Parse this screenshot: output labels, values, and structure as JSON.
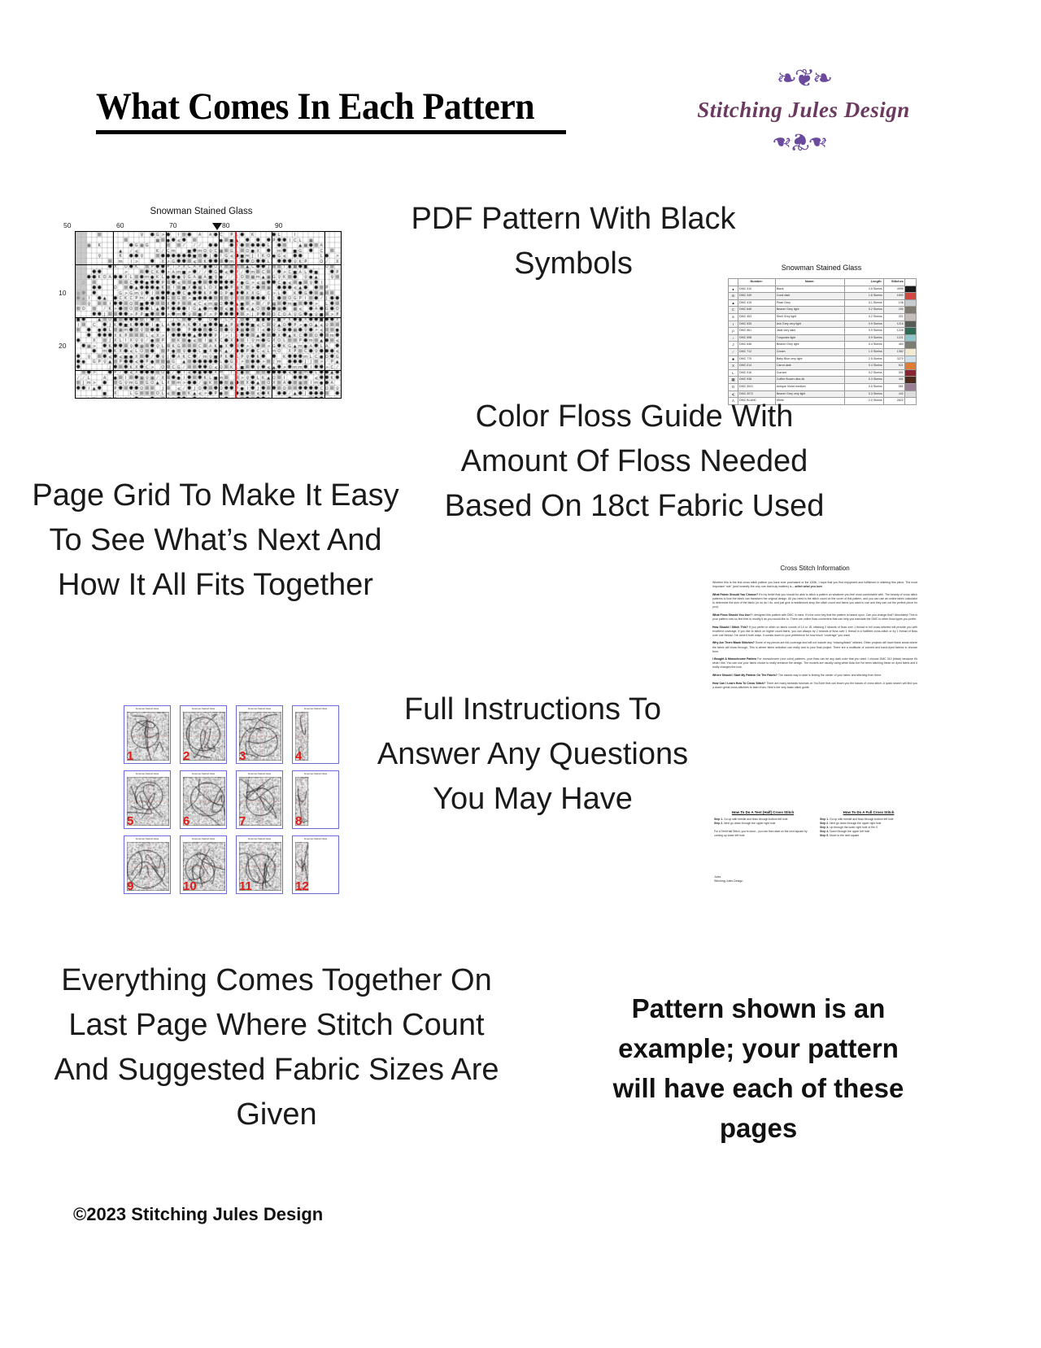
{
  "header": {
    "title": "What Comes In Each Pattern",
    "brand_name": "Stitching Jules Design",
    "flourish_top": "❧❦❧",
    "flourish_bottom": "❧❦❧"
  },
  "captions": {
    "pdf_pattern": "PDF Pattern With Black Symbols",
    "floss_guide": "Color Floss Guide With Amount Of Floss Needed Based On 18ct Fabric Used",
    "page_grid": "Page Grid To Make It Easy To See What’s Next And How It All Fits Together",
    "instructions": "Full Instructions To Answer Any Questions You May Have",
    "last_page": "Everything Comes Together On Last Page Where Stitch Count And Suggested Fabric Sizes Are Given",
    "example_note": "Pattern shown is an example; your pattern will have each of these pages"
  },
  "footer": {
    "copyright": "©2023 Stitching Jules Design"
  },
  "chart_thumb": {
    "title": "Snowman Stained Glass",
    "column_labels": [
      "50",
      "60",
      "70",
      "80",
      "90"
    ],
    "row_labels": [
      "10",
      "20"
    ],
    "center_line_color": "#e8242a"
  },
  "floss_thumb": {
    "title": "Snowman Stained Glass",
    "columns": [
      "",
      "Number:",
      "Name:",
      "Length:",
      "Stitches"
    ],
    "rows": [
      {
        "symbol": "●",
        "number": "DMC   310",
        "name": "Black",
        "length": "3.5 Skeins",
        "stitches": "4999",
        "color": "#1a1a1a"
      },
      {
        "symbol": "m",
        "number": "DMC   349",
        "name": "Coral dark",
        "length": "1.6 Skeins",
        "stitches": "1690",
        "color": "#d0483f"
      },
      {
        "symbol": "▲",
        "number": "DMC   415",
        "name": "Pearl Grey",
        "length": "0.1 Skeins",
        "stitches": "108",
        "color": "#c9cccf"
      },
      {
        "symbol": "C",
        "number": "DMC   646",
        "name": "Beaver Grey light",
        "length": "0.2 Skeins",
        "stitches": "250",
        "color": "#7d7b72"
      },
      {
        "symbol": "6",
        "number": "DMC   453",
        "name": "Shell Grey light",
        "length": "0.2 Skeins",
        "stitches": "321",
        "color": "#c6bcb8"
      },
      {
        "symbol": "I",
        "number": "DMC   535",
        "name": "Ash Grey very light",
        "length": "0.9 Skeins",
        "stitches": "1216",
        "color": "#5a5b57"
      },
      {
        "symbol": "ρ",
        "number": "DMC   561",
        "name": "Jade very dark",
        "length": "0.9 Skeins",
        "stitches": "1226",
        "color": "#2e6b54"
      },
      {
        "symbol": "♀",
        "number": "DMC   598",
        "name": "Turquoise light",
        "length": "0.9 Skeins",
        "stitches": "1221",
        "color": "#8fc6cc"
      },
      {
        "symbol": "J",
        "number": "DMC   646",
        "name": "Beaver Grey light",
        "length": "0.4 Skeins",
        "stitches": "483",
        "color": "#7d7b72"
      },
      {
        "symbol": "⁄",
        "number": "DMC   712",
        "name": "Cream",
        "length": "1.0 Skeins",
        "stitches": "1382",
        "color": "#f3ead5"
      },
      {
        "symbol": "■",
        "number": "DMC   775",
        "name": "Baby Blue very light",
        "length": "2.5 Skeins",
        "stitches": "3270",
        "color": "#cfe0ee"
      },
      {
        "symbol": "X",
        "number": "DMC   014",
        "name": "Carrot dark",
        "length": "0.4 Skeins",
        "stitches": "521",
        "color": "#e07b33"
      },
      {
        "symbol": "L",
        "number": "DMC   016",
        "name": "Currant",
        "length": "0.2 Skeins",
        "stitches": "301",
        "color": "#8a2430"
      },
      {
        "symbol": "▦",
        "number": "DMC   938",
        "name": "Coffee Brown ultra dk",
        "length": "0.3 Skeins",
        "stitches": "441",
        "color": "#4a2b1c"
      },
      {
        "symbol": "O",
        "number": "DMC   3041",
        "name": "Antique Violet medium",
        "length": "0.5 Skeins",
        "stitches": "561",
        "color": "#9a7f94"
      },
      {
        "symbol": "⩽",
        "number": "DMC   3072",
        "name": "Beaver Grey very light",
        "length": "0.3 Skeins",
        "stitches": "442",
        "color": "#dcdedb"
      },
      {
        "symbol": "Λ",
        "number": "DMC   BLANC",
        "name": "White",
        "length": "2.0 Skeins",
        "stitches": "2622",
        "color": "#ffffff"
      }
    ]
  },
  "page_grid": {
    "thumb_title": "Snowman Stained Glass",
    "pages": [
      {
        "number": "1",
        "kind": "full"
      },
      {
        "number": "2",
        "kind": "full"
      },
      {
        "number": "3",
        "kind": "full"
      },
      {
        "number": "4",
        "kind": "edge"
      },
      {
        "number": "5",
        "kind": "full"
      },
      {
        "number": "6",
        "kind": "full"
      },
      {
        "number": "7",
        "kind": "full"
      },
      {
        "number": "8",
        "kind": "edge"
      },
      {
        "number": "9",
        "kind": "full"
      },
      {
        "number": "10",
        "kind": "full"
      },
      {
        "number": "11",
        "kind": "full"
      },
      {
        "number": "12",
        "kind": "edge"
      }
    ],
    "border_color": "#6a6ad6",
    "number_color": "#e01b16"
  },
  "instructions_doc": {
    "title": "Cross Stitch Information",
    "paragraphs": [
      "Whether this is the first cross stitch pattern you have ever purchased or the 100th, I hope that you find enjoyment and fulfillment in stitching this piece. The most important “rule” (and honestly the only one that truly matters) is – stitch what you love.",
      "What Fabric Should You Choose? It's my belief that you should be able to stitch a pattern on whatever you feel most comfortable with. The beauty of cross stitch patterns is how the fabric can transform the original design.  All you need is the stitch count on the cover of this pattern, and you can use an online fabric calculator to determine the size of the fabric (or do as I do, and just give a needlework shop the stitch count and fabric you want to use and they can cut the perfect piece for you).",
      "What Floss Should You Use? I designed this pattern with DMC in mind. It's the color key that the pattern is based upon. Can you change that? Absolutely! This is your pattern now so feel free to modify it as you would like to.  There are online floss converters that can help you translate the DMC to other floss types you prefer.",
      "How Should I Stitch This? If you prefer to stitch on fabric counts of 14 or 18, stitching 2 strands of floss over 1 thread in full cross-stitches will provide you with excellent coverage. If you like to stitch on higher count fabric, you can always try 2 strands of floss over 1 thread in a half/tent cross-stitch or try 1 thread of floss over one thread. I've done it both ways. It comes down to your preference for how much “coverage” you want.",
      "Why Are There Blank Stitches? Some of my pieces are full-coverage and will not include any “missing/blank” stitches. Other projects will have blank areas where the fabric will show through. This is where fabric selection can really add to your final project. There are a multitude of colored and hand-dyed fabrics to choose from.",
      "I Bought A Monochrome Pattern For monochrome (one color) patterns, your floss can be any dark color that you want. I choose DMC 310 (black) because it's what I like. You can use your fabric choice to really enhance the design. The models are usually using white Aida but I've been stitching these on dyed fabric and it really changes the look.",
      "Where Should I Start My Pattern On The Fabric? The classic way to start is finding the center of your fabric and stitching from there.",
      "How Can I Learn How To Cross Stitch? There are many fantastic tutorials on YouTube that can teach you the basics of cross stitch. A quick search will find you a dozen great cross-stitchers to learn from. Here's the very basic stitch guide."
    ],
    "stitch_guides": [
      {
        "heading": "How To Do A Tent (Half) Cross Stitch",
        "steps": [
          "Step 1. Go up with needle and floss through bottom left hole",
          "Step 2. Next go down through the upper right hole"
        ],
        "note": "For A Tent/Half Stitch, you're done - you can then start on the next square by coming up lower left hole."
      },
      {
        "heading": "How To Do A Full Cross Stitch",
        "steps": [
          "Step 1. Go up with needle and floss through bottom left hole",
          "Step 2. Next go down through the upper right hole",
          "Step 3. Up through the lower right hole of the X",
          "Step 4. Down through the upper left hole",
          "Step 5. Move to the next square"
        ],
        "note": ""
      }
    ],
    "signature": "Jules\nStitching Jules Design"
  }
}
